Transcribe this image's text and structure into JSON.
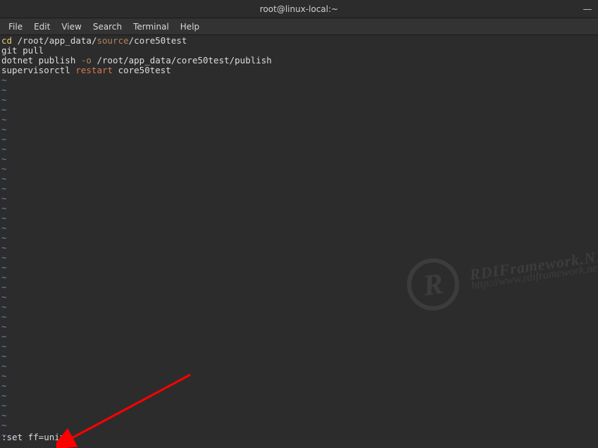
{
  "titlebar": {
    "title": "root@linux-local:~"
  },
  "window_controls": {
    "minimize": "—"
  },
  "menubar": {
    "items": [
      "File",
      "Edit",
      "View",
      "Search",
      "Terminal",
      "Help"
    ]
  },
  "editor": {
    "lines": [
      {
        "segments": [
          {
            "cls": "hl-cmd",
            "text": "cd"
          },
          {
            "cls": "hl-white",
            "text": " /root/app_data/"
          },
          {
            "cls": "hl-path1",
            "text": "source"
          },
          {
            "cls": "hl-white",
            "text": "/core50test"
          }
        ]
      },
      {
        "segments": [
          {
            "cls": "hl-white",
            "text": "git pull"
          }
        ]
      },
      {
        "segments": [
          {
            "cls": "hl-white",
            "text": "dotnet publish "
          },
          {
            "cls": "hl-option",
            "text": "-o"
          },
          {
            "cls": "hl-white",
            "text": " /root/app_data/core50test/publish"
          }
        ]
      },
      {
        "segments": [
          {
            "cls": "hl-white",
            "text": "supervisorctl "
          },
          {
            "cls": "hl-action",
            "text": "restart"
          },
          {
            "cls": "hl-white",
            "text": " core50test"
          }
        ]
      }
    ],
    "tilde": "~",
    "tilde_count": 37
  },
  "command_line": {
    "text": ":set ff=unix"
  },
  "watermark": {
    "brand_line1": "RDIFramework.NET",
    "brand_line2": "http://www.rdiframework.net"
  }
}
